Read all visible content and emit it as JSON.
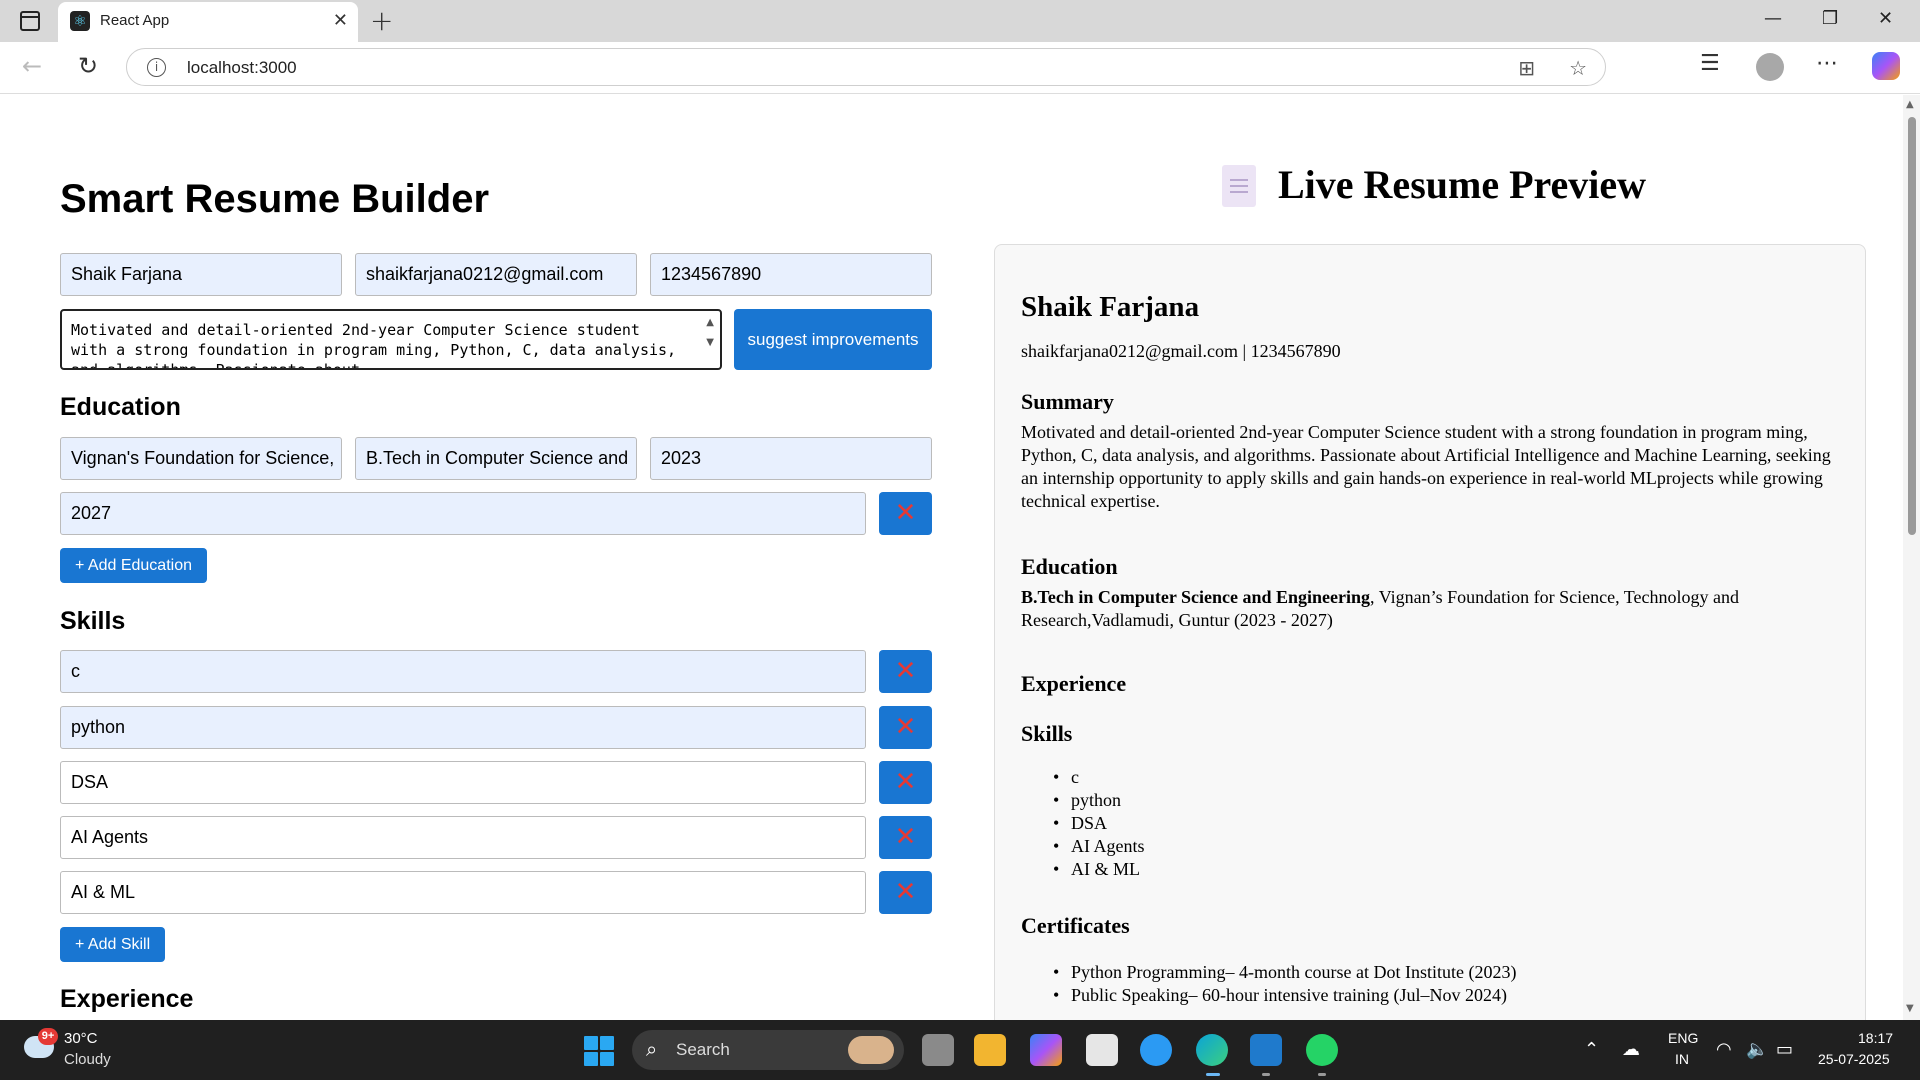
{
  "browser": {
    "tab_title": "React App",
    "tab_close": "✕",
    "new_tab": "+",
    "url": "localhost:3000",
    "icons": [
      "sidebar-toggle-icon",
      "react-favicon-icon",
      "back-icon",
      "refresh-icon",
      "info-icon",
      "apps-icon",
      "favorite-icon",
      "favorites-icon",
      "profile-icon",
      "more-icon",
      "copilot-icon"
    ]
  },
  "editor": {
    "title": "Smart Resume Builder",
    "name": "Shaik Farjana",
    "email": "shaikfarjana0212@gmail.com",
    "phone": "1234567890",
    "summary_text": "Motivated and detail-oriented 2nd-year Computer Science student with a strong foundation in program ming, Python, C, data analysis, and algorithms. Passionate about",
    "suggest_label": "suggest improvements",
    "education_heading": "Education",
    "education": {
      "institution": "Vignan's Foundation for Science,",
      "degree": "B.Tech in Computer Science and",
      "start_year": "2023",
      "end_year": "2027"
    },
    "add_education_label": "+ Add Education",
    "skills_heading": "Skills",
    "skills": [
      "c",
      "python",
      "DSA",
      "AI Agents",
      "AI & ML"
    ],
    "add_skill_label": "+ Add Skill",
    "experience_heading": "Experience",
    "delete_symbol": "✕"
  },
  "preview": {
    "title": "Live Resume Preview",
    "name": "Shaik Farjana",
    "contact": "shaikfarjana0212@gmail.com | 1234567890",
    "summary_heading": "Summary",
    "summary": "Motivated and detail-oriented 2nd-year Computer Science student with a strong foundation in program ming, Python, C, data analysis, and algorithms. Passionate about Artificial Intelligence and Machine Learning, seeking an internship opportunity to apply skills and gain hands-on experience in real-world MLprojects while growing technical expertise.",
    "education_heading": "Education",
    "education_degree": "B.Tech in Computer Science and Engineering",
    "education_rest": ", Vignan’s Foundation for Science, Technology and Research,Vadlamudi, Guntur (2023 - 2027)",
    "experience_heading": "Experience",
    "skills_heading": "Skills",
    "skills": [
      "c",
      "python",
      "DSA",
      "AI Agents",
      "AI & ML"
    ],
    "certificates_heading": "Certificates",
    "certificates": [
      "Python Programming– 4-month course at Dot Institute (2023)",
      "Public Speaking– 60-hour intensive training (Jul–Nov 2024)"
    ]
  },
  "taskbar": {
    "weather_badge": "9+",
    "temperature": "30°C",
    "condition": "Cloudy",
    "search_label": "Search",
    "lang_line1": "ENG",
    "lang_line2": "IN",
    "time": "18:17",
    "date": "25-07-2025"
  },
  "colors": {
    "accent": "#1976d2",
    "delete_icon": "#e53935",
    "input_fill": "#e8f0fe"
  }
}
